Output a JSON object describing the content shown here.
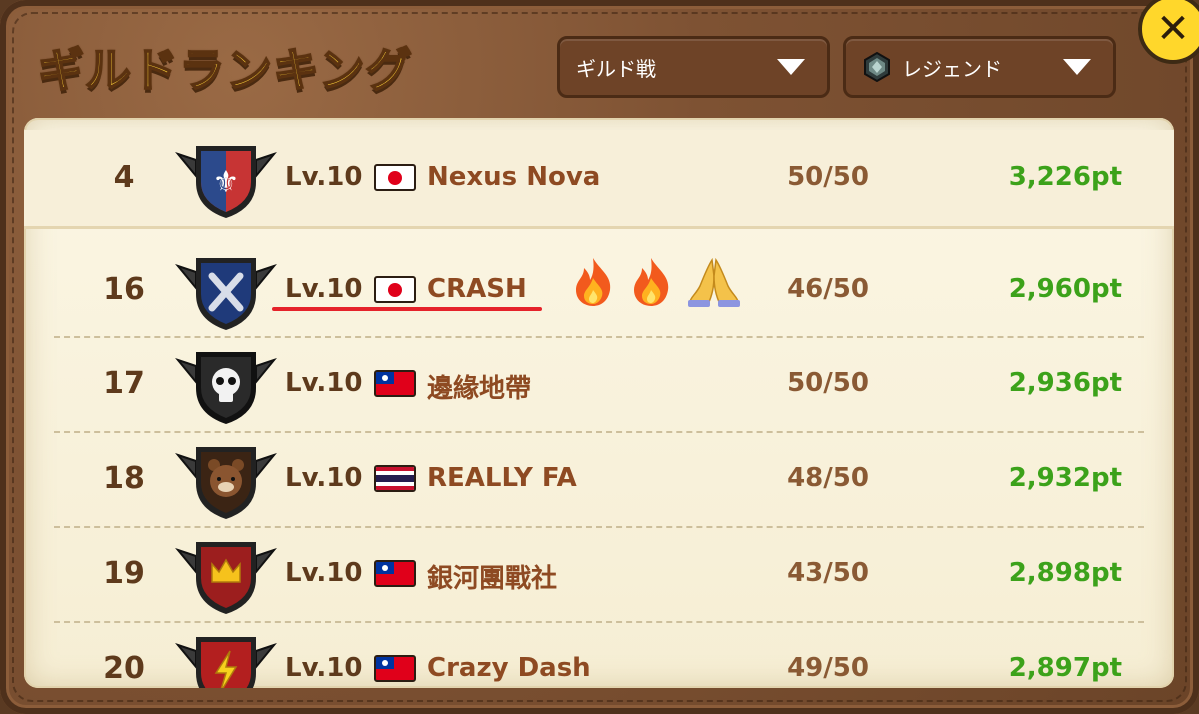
{
  "header": {
    "title": "ギルドランキング",
    "close_icon": "close-icon"
  },
  "filters": {
    "mode": {
      "label": "ギルド戦",
      "icon": "chevron-down-icon"
    },
    "league": {
      "label": "レジェンド",
      "icon": "legend-gem-icon"
    }
  },
  "rows": [
    {
      "rank": "4",
      "level": "Lv.10",
      "flag": "jp",
      "name": "Nexus Nova",
      "members": "50/50",
      "points": "3,226pt",
      "emblem": "fleur-de-lis-shield-icon"
    },
    {
      "rank": "16",
      "level": "Lv.10",
      "flag": "jp",
      "name": "CRASH",
      "members": "46/50",
      "points": "2,960pt",
      "emblem": "crossed-swords-shield-icon",
      "highlighted": true
    },
    {
      "rank": "17",
      "level": "Lv.10",
      "flag": "tw",
      "name": "邊緣地帶",
      "members": "50/50",
      "points": "2,936pt",
      "emblem": "skull-shield-icon"
    },
    {
      "rank": "18",
      "level": "Lv.10",
      "flag": "th",
      "name": "REALLY FA",
      "members": "48/50",
      "points": "2,932pt",
      "emblem": "bear-shield-icon"
    },
    {
      "rank": "19",
      "level": "Lv.10",
      "flag": "tw",
      "name": "銀河團戰社",
      "members": "43/50",
      "points": "2,898pt",
      "emblem": "crown-shield-icon"
    },
    {
      "rank": "20",
      "level": "Lv.10",
      "flag": "tw",
      "name": "Crazy Dash",
      "members": "49/50",
      "points": "2,897pt",
      "emblem": "lightning-shield-icon"
    }
  ],
  "colors": {
    "title": "#ffd43a",
    "points": "#3ca21a",
    "guild_name": "#8e4a22",
    "highlight_underline": "#e5222a"
  }
}
